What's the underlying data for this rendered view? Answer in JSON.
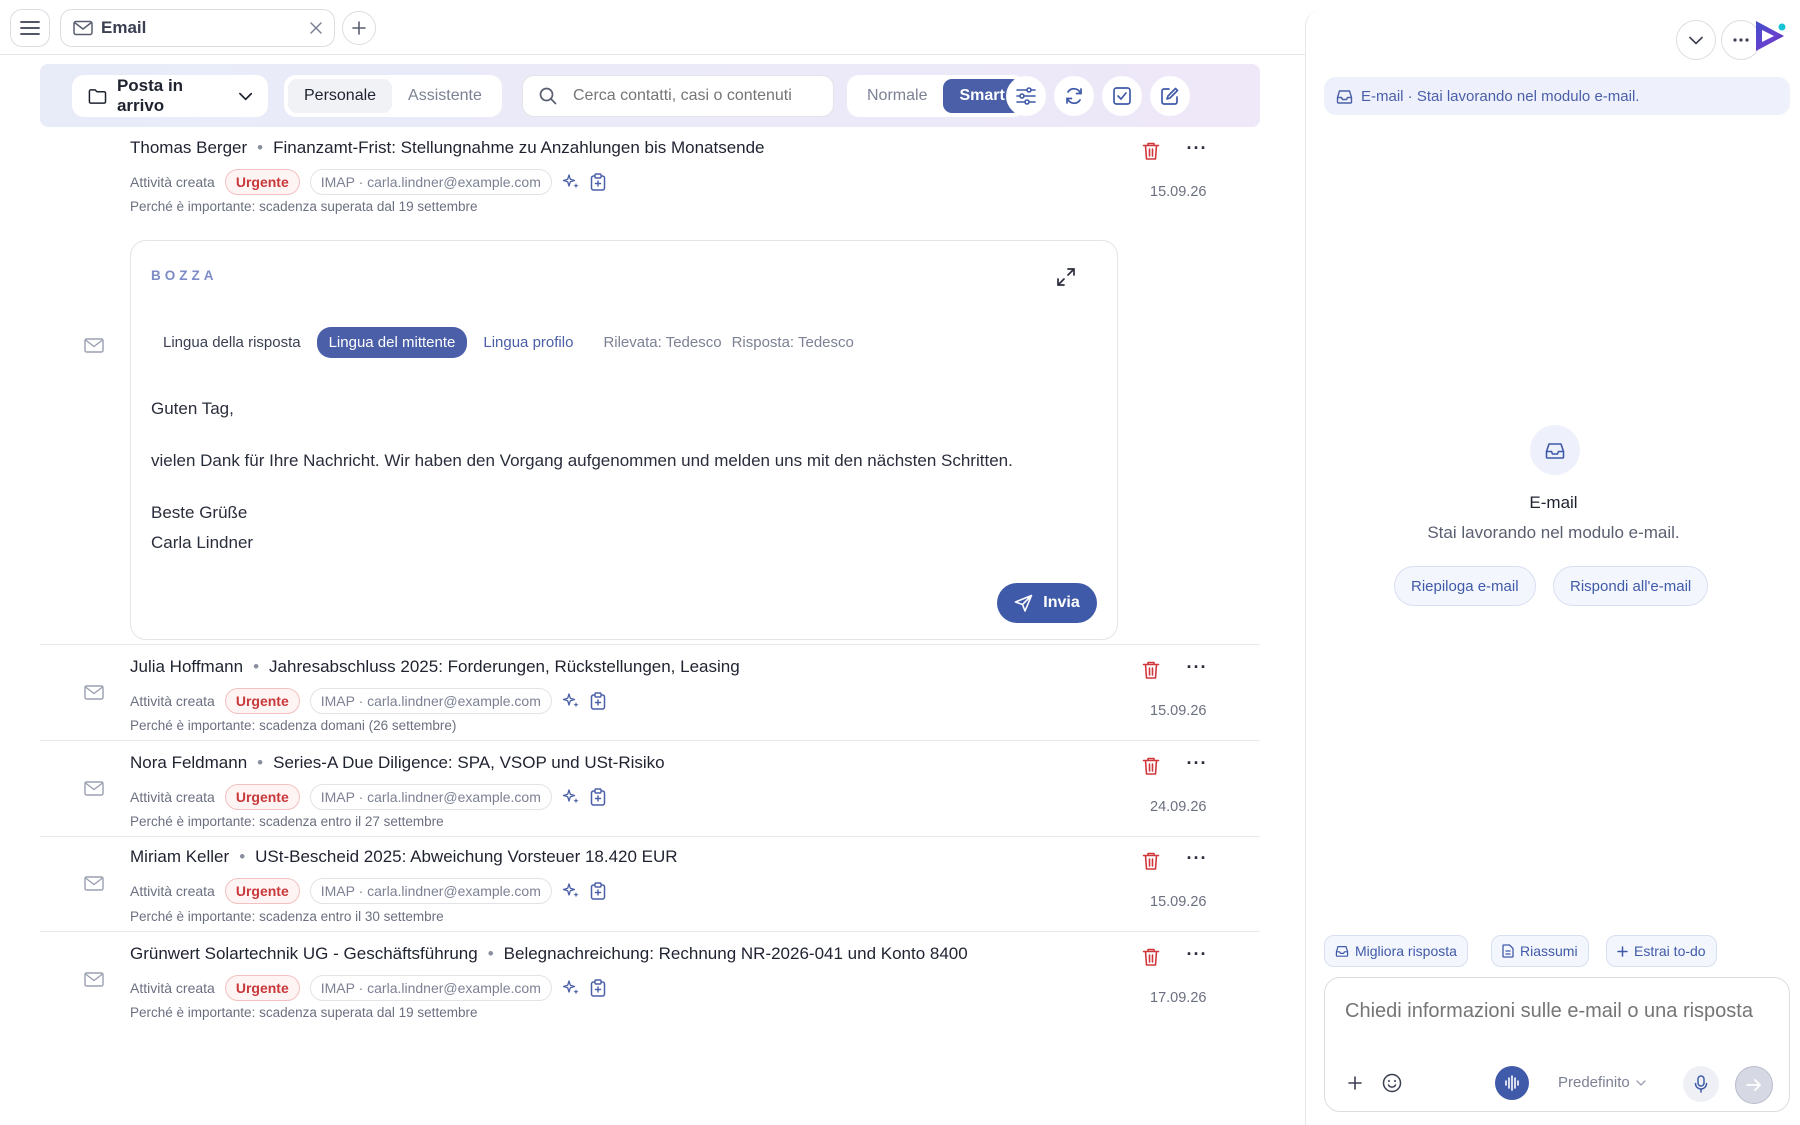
{
  "tab": {
    "label": "Email"
  },
  "toolbar": {
    "folder": "Posta in arrivo",
    "scope_tabs": [
      "Personale",
      "Assistente"
    ],
    "search_placeholder": "Cerca contatti, casi o contenuti",
    "mode_tabs": [
      "Normale",
      "Smart"
    ]
  },
  "emails": [
    {
      "sender": "Thomas Berger",
      "subject": "Finanzamt-Frist: Stellungnahme zu Anzahlungen bis Monatsende",
      "activity": "Attività creata",
      "badge": "Urgente",
      "account": "IMAP · carla.lindner@example.com",
      "why": "Perché è importante: scadenza superata dal 19 settembre",
      "date": "15.09.26"
    },
    {
      "sender": "Julia Hoffmann",
      "subject": "Jahresabschluss 2025: Forderungen, Rückstellungen, Leasing",
      "activity": "Attività creata",
      "badge": "Urgente",
      "account": "IMAP · carla.lindner@example.com",
      "why": "Perché è importante: scadenza domani (26 settembre)",
      "date": "15.09.26"
    },
    {
      "sender": "Nora Feldmann",
      "subject": "Series-A Due Diligence: SPA, VSOP und USt-Risiko",
      "activity": "Attività creata",
      "badge": "Urgente",
      "account": "IMAP · carla.lindner@example.com",
      "why": "Perché è importante: scadenza entro il 27 settembre",
      "date": "24.09.26"
    },
    {
      "sender": "Miriam Keller",
      "subject": "USt-Bescheid 2025: Abweichung Vorsteuer 18.420 EUR",
      "activity": "Attività creata",
      "badge": "Urgente",
      "account": "IMAP · carla.lindner@example.com",
      "why": "Perché è importante: scadenza entro il 30 settembre",
      "date": "15.09.26"
    },
    {
      "sender": "Grünwert Solartechnik UG - Geschäftsführung",
      "subject": "Belegnachreichung: Rechnung NR-2026-041 und Konto 8400",
      "activity": "Attività creata",
      "badge": "Urgente",
      "account": "IMAP · carla.lindner@example.com",
      "why": "Perché è importante: scadenza superata dal 19 settembre",
      "date": "17.09.26"
    }
  ],
  "draft": {
    "title": "BOZZA",
    "lang_label": "Lingua della risposta",
    "lang_options": [
      "Lingua del mittente",
      "Lingua profilo"
    ],
    "detected": "Rilevata: Tedesco",
    "reply": "Risposta: Tedesco",
    "body": [
      "Guten Tag,",
      "vielen Dank für Ihre Nachricht. Wir haben den Vorgang aufgenommen und melden uns mit den nächsten Schritten.",
      "Beste Grüße",
      "Carla Lindner"
    ],
    "send_label": "Invia"
  },
  "assistant": {
    "context": "E-mail · Stai lavorando nel modulo e-mail.",
    "title": "E-mail",
    "subtitle": "Stai lavorando nel modulo e-mail.",
    "quick_actions": [
      "Riepiloga e-mail",
      "Rispondi all'e-mail"
    ],
    "chips": [
      "Migliora risposta",
      "Riassumi",
      "Estrai to-do"
    ],
    "input_placeholder": "Chiedi informazioni sulle e-mail o una risposta",
    "model": "Predefinito"
  },
  "colors": {
    "accent": "#4a5fa8",
    "urgent": "#c8383b",
    "trash": "#d0383b"
  }
}
